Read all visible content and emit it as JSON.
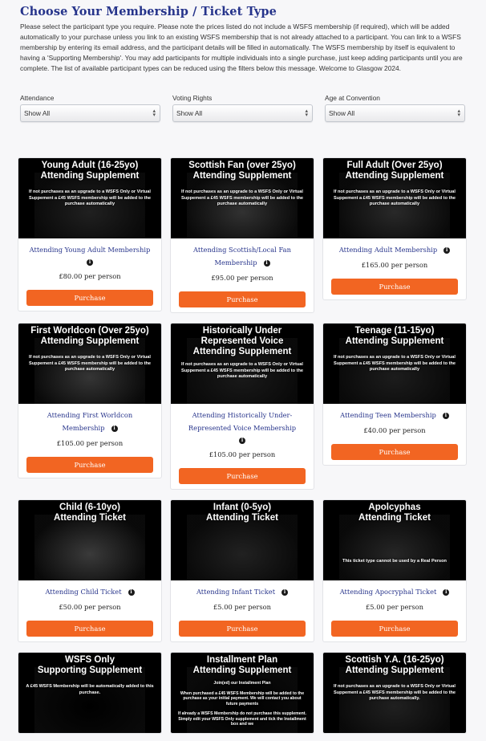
{
  "page": {
    "title": "Choose Your Membership / Ticket Type",
    "intro": "Please select the participant type you require. Please note the prices listed do not include a WSFS membership (if required), which will be added automatically to your purchase unless you link to an existing WSFS membership that is not already attached to a participant. You can link to a WSFS membership by entering its email address, and the participant details will be filled in automatically. The WSFS membership by itself is equivalent to having a 'Supporting Membership'. You may add participants for multiple individuals into a single purchase, just keep adding participants until you are complete. The list of available participant types can be reduced using the filters below this message. Welcome to Glasgow 2024."
  },
  "filters": [
    {
      "label": "Attendance",
      "value": "Show All"
    },
    {
      "label": "Voting Rights",
      "value": "Show All"
    },
    {
      "label": "Age at Convention",
      "value": "Show All"
    }
  ],
  "colors": {
    "title": "#26348b",
    "link": "#27348b",
    "button": "#f26522",
    "background": "#f7f7f9"
  },
  "info_icon": "info-circle-icon",
  "purchase_label": "Purchase",
  "cards": [
    {
      "image_title": "Young Adult (16-25yo)\nAttending Supplement",
      "image_note": "If not purchases as an upgrade to a WSFS Only or Virtual Suppement a £45 WSFS membership will be added to the purchase automatically",
      "name": "Attending Young Adult Membership",
      "price": "£80.00 per person",
      "tint": "#3a3a3a"
    },
    {
      "image_title": "Scottish Fan (over 25yo)\nAttending Supplement",
      "image_note": "If not purchases as an upgrade to a WSFS Only or Virtual Suppement a £45 WSFS membership will be added to the purchase automatically",
      "name": "Attending Scottish/Local Fan Membership",
      "price": "£95.00 per person",
      "tint": "#5a5a5a"
    },
    {
      "image_title": "Full Adult (Over 25yo)\nAttending Supplement",
      "image_note": "If not purchases as an upgrade to a WSFS Only or Virtual Suppement a £45 WSFS membership will be added to the purchase automatically",
      "name": "Attending Adult Membership",
      "price": "£165.00 per person",
      "tint": "#4a4a4a"
    },
    {
      "image_title": "First Worldcon (Over 25yo)\nAttending Supplement",
      "image_note": "If not purchases as an upgrade to a WSFS Only or Virtual Suppement a £45 WSFS membership will be added to the purchase automatically",
      "name": "Attending First Worldcon Membership",
      "price": "£105.00 per person",
      "tint": "#606060"
    },
    {
      "image_title": "Historically Under\nRepresented Voice\nAttending Supplement",
      "image_note": "If not purchases as an upgrade to a WSFS Only or Virtual Suppement a £45 WSFS membership will be added to the purchase automatically",
      "name": "Attending Historically Under-Represented Voice Membership",
      "price": "£105.00 per person",
      "tint": "#2e2e2e"
    },
    {
      "image_title": "Teenage (11-15yo)\nAttending Supplement",
      "image_note": "If not purchases as an upgrade to a WSFS Only or Virtual Suppement a £45 WSFS membership will be added to the purchase automatically",
      "name": "Attending Teen Membership",
      "price": "£40.00 per person",
      "tint": "#333333"
    },
    {
      "image_title": "Child (6-10yo)\nAttending Ticket",
      "image_note": "",
      "name": "Attending Child Ticket",
      "price": "£50.00 per person",
      "tint": "#6a6a6a"
    },
    {
      "image_title": "Infant (0-5yo)\nAttending Ticket",
      "image_note": "",
      "name": "Attending Infant Ticket",
      "price": "£5.00 per person",
      "tint": "#3c3c3c"
    },
    {
      "image_title": "Apolcyphas\nAttending Ticket",
      "image_note": "This ticket type cannot be used by a Real Person",
      "name": "Attending Apocryphal Ticket",
      "price": "£5.00 per person",
      "tint": "#454545"
    },
    {
      "image_title": "WSFS Only\nSupporting Supplement",
      "image_note": "A £45 WSFS Membership will be automatically added to this purchase.",
      "name": "",
      "price": "",
      "tint": "#000000"
    },
    {
      "image_title": "Installment Plan\nAttending Supplement",
      "image_note": "Join(ed) our Installment Plan\n\nWhen purchased a £45 WSFS Membership will be added to the purchase as your initial payment. We will contact you about future payments\n\nIf already a WSFS Membership do not purchase this supplement. Simply edit your WSFS Only supplement and tick the Installment box and we",
      "name": "",
      "price": "",
      "tint": "#000000"
    },
    {
      "image_title": "Scottish Y.A. (16-25yo)\nAttending Supplement",
      "image_note": "If not purchases as an upgrade to a WSFS Only or Virtual Suppement a £45 WSFS membership will be added to the purchase automatically.",
      "name": "",
      "price": "",
      "tint": "#3a3a3a"
    }
  ]
}
